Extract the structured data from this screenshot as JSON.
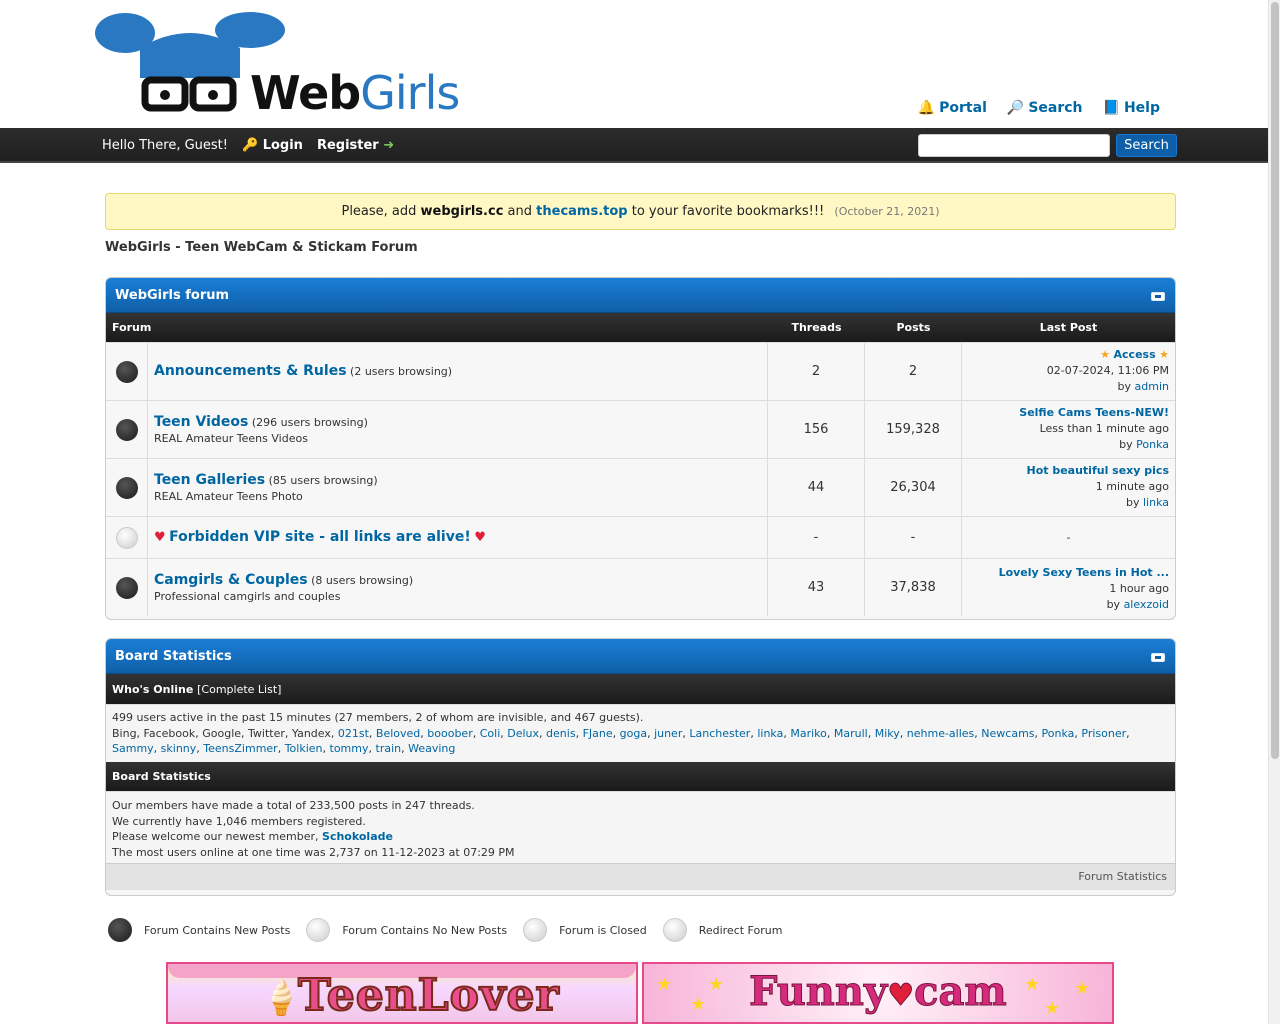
{
  "header": {
    "logo_web": "Web",
    "logo_girls": "Girls",
    "links": [
      "Portal",
      "Search",
      "Help"
    ]
  },
  "panel": {
    "welcome": "Hello There, Guest!",
    "login": "Login",
    "register": "Register",
    "search_button": "Search",
    "search_value": ""
  },
  "announcement": {
    "prefix": "Please, add",
    "site1": "webgirls.cc",
    "and": "and",
    "site2": "thecams.top",
    "suffix": "to your favorite bookmarks!!!",
    "date": "(October 21, 2021)"
  },
  "board_title": "WebGirls - Teen WebCam & Stickam Forum",
  "forum": {
    "title": "WebGirls forum",
    "headers": {
      "forum": "Forum",
      "threads": "Threads",
      "posts": "Posts",
      "last_post": "Last Post"
    },
    "rows": [
      {
        "title": "Announcements & Rules",
        "browsing": "(2 users browsing)",
        "desc": "",
        "threads": "2",
        "posts": "2",
        "lp_title": "Access",
        "lp_time": "02-07-2024, 11:06 PM",
        "lp_by": "by",
        "lp_user": "admin"
      },
      {
        "title": "Teen Videos",
        "browsing": "(296 users browsing)",
        "desc": "REAL Amateur Teens Videos",
        "threads": "156",
        "posts": "159,328",
        "lp_title": "Selfie Cams Teens-NEW!",
        "lp_time": "Less than 1 minute ago",
        "lp_by": "by",
        "lp_user": "Ponka"
      },
      {
        "title": "Teen Galleries",
        "browsing": "(85 users browsing)",
        "desc": "REAL Amateur Teens Photo",
        "threads": "44",
        "posts": "26,304",
        "lp_title": "Hot beautiful sexy pics",
        "lp_time": "1 minute ago",
        "lp_by": "by",
        "lp_user": "linka"
      },
      {
        "title": "Forbidden VIP site - all links are alive!",
        "browsing": "",
        "desc": "",
        "threads": "-",
        "posts": "-",
        "lp_title": "-",
        "lp_time": "",
        "lp_by": "",
        "lp_user": ""
      },
      {
        "title": "Camgirls & Couples",
        "browsing": "(8 users browsing)",
        "desc": "Professional camgirls and couples",
        "threads": "43",
        "posts": "37,838",
        "lp_title": "Lovely Sexy Teens in Hot ...",
        "lp_time": "1 hour ago",
        "lp_by": "by",
        "lp_user": "alexzoid"
      }
    ]
  },
  "stats": {
    "title": "Board Statistics",
    "whos_online": "Who's Online",
    "complete_list": "[Complete List]",
    "online_summary": "499 users active in the past 15 minutes (27 members, 2 of whom are invisible, and 467 guests).",
    "bots": "Bing, Facebook, Google, Twitter, Yandex,",
    "members": [
      "021st",
      "Beloved",
      "booober",
      "Coli",
      "Delux",
      "denis",
      "FJane",
      "goga",
      "juner",
      "Lanchester",
      "linka",
      "Mariko",
      "Marull",
      "Miky",
      "nehme-alles",
      "Newcams",
      "Ponka",
      "Prisoner",
      "Sammy",
      "skinny",
      "TeensZimmer",
      "Tolkien",
      "tommy",
      "train",
      "Weaving"
    ],
    "board_stats_header": "Board Statistics",
    "line1": "Our members have made a total of 233,500 posts in 247 threads.",
    "line2": "We currently have 1,046 members registered.",
    "line3_prefix": "Please welcome our newest member,",
    "newest_member": "Schokolade",
    "line4": "The most users online at one time was 2,737 on 11-12-2023 at 07:29 PM",
    "footer_link": "Forum Statistics"
  },
  "legend": [
    "Forum Contains New Posts",
    "Forum Contains No New Posts",
    "Forum is Closed",
    "Redirect Forum"
  ],
  "banners": {
    "left": "TeenLover",
    "right_a": "Funny",
    "right_b": "cam"
  }
}
